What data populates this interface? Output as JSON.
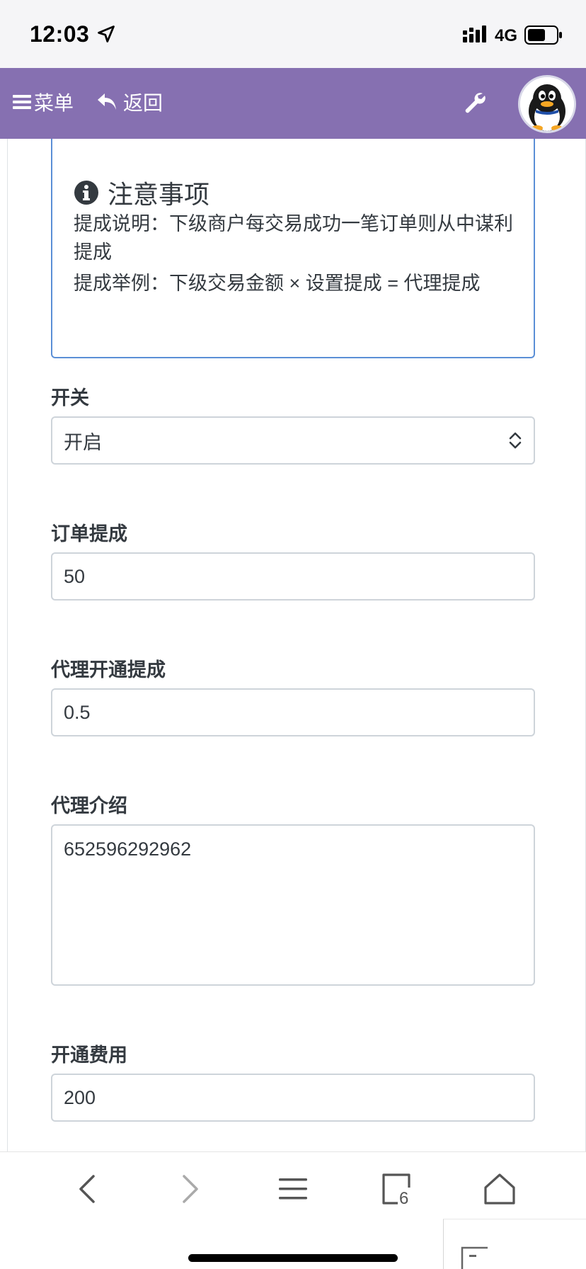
{
  "status_bar": {
    "time": "12:03",
    "network": "4G"
  },
  "header": {
    "menu_label": "菜单",
    "back_label": "返回"
  },
  "notice": {
    "title": "注意事项",
    "line1": "提成说明：下级商户每交易成功一笔订单则从中谋利提成",
    "line2": "提成举例：下级交易金额 × 设置提成 = 代理提成"
  },
  "form": {
    "switch": {
      "label": "开关",
      "value": "开启"
    },
    "order_commission": {
      "label": "订单提成",
      "value": "50"
    },
    "agent_commission": {
      "label": "代理开通提成",
      "value": "0.5"
    },
    "agent_intro": {
      "label": "代理介绍",
      "value": "652596292962"
    },
    "open_fee": {
      "label": "开通费用",
      "value": "200"
    }
  },
  "toolbar": {
    "tabs_count": "6"
  },
  "colors": {
    "header_bg": "#8670b1",
    "notice_border": "#5b8fd6",
    "input_border": "#ced4da"
  }
}
